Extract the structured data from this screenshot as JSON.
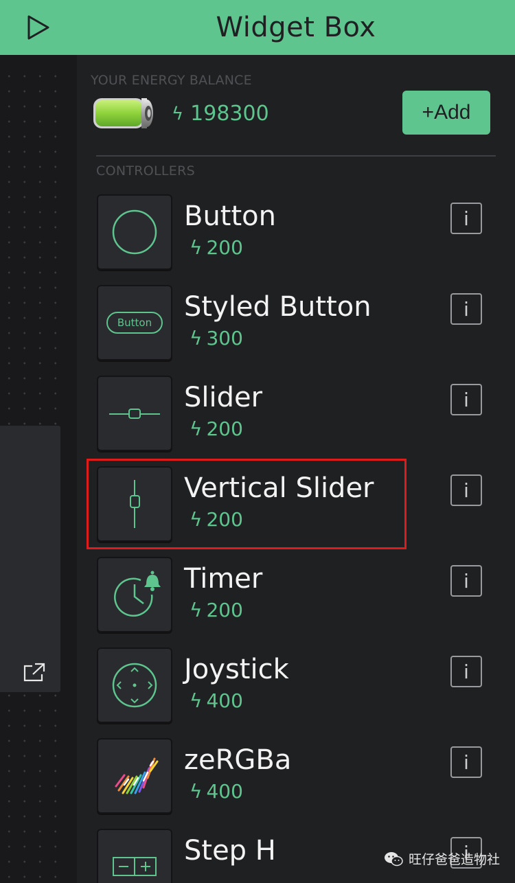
{
  "header": {
    "title": "Widget Box"
  },
  "energy": {
    "label": "YOUR ENERGY BALANCE",
    "bolt": "ϟ",
    "value": "198300",
    "add_label": "+Add"
  },
  "section": {
    "label": "CONTROLLERS"
  },
  "widgets": [
    {
      "name": "Button",
      "bolt": "ϟ",
      "cost": "200",
      "info": "i",
      "icon": "circle-icon"
    },
    {
      "name": "Styled Button",
      "bolt": "ϟ",
      "cost": "300",
      "info": "i",
      "icon": "styled-button-icon",
      "thumb_text": "Button"
    },
    {
      "name": "Slider",
      "bolt": "ϟ",
      "cost": "200",
      "info": "i",
      "icon": "slider-icon"
    },
    {
      "name": "Vertical Slider",
      "bolt": "ϟ",
      "cost": "200",
      "info": "i",
      "icon": "vertical-slider-icon",
      "highlighted": true
    },
    {
      "name": "Timer",
      "bolt": "ϟ",
      "cost": "200",
      "info": "i",
      "icon": "timer-icon"
    },
    {
      "name": "Joystick",
      "bolt": "ϟ",
      "cost": "400",
      "info": "i",
      "icon": "joystick-icon"
    },
    {
      "name": "zeRGBa",
      "bolt": "ϟ",
      "cost": "400",
      "info": "i",
      "icon": "zebra-icon"
    },
    {
      "name": "Step H",
      "bolt": "ϟ",
      "cost": "",
      "info": "i",
      "icon": "step-h-icon"
    }
  ],
  "watermark": {
    "text": "旺仔爸爸造物社"
  },
  "colors": {
    "accent": "#5fc58f",
    "background": "#1f2022",
    "highlight": "#e01b1b"
  }
}
